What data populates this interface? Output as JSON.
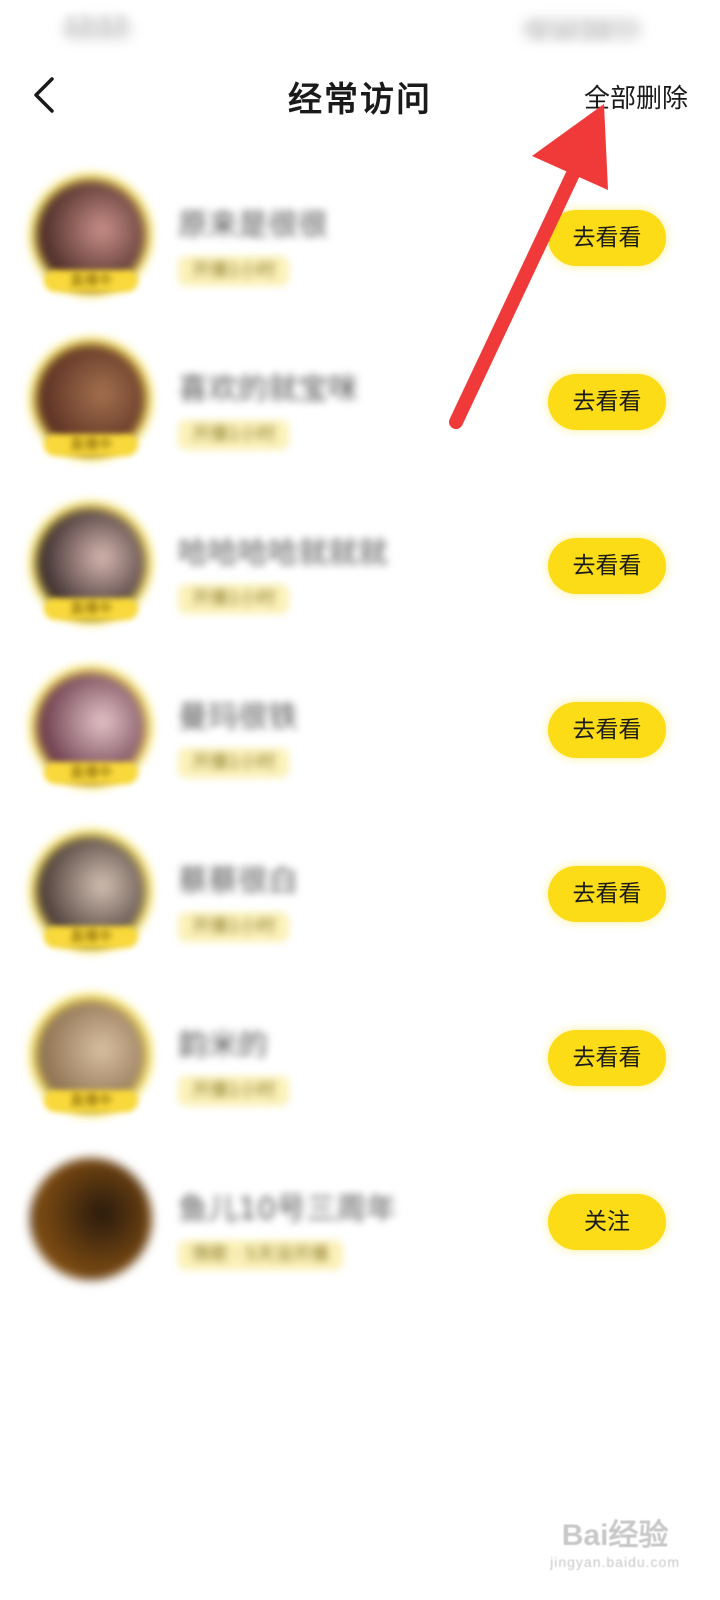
{
  "status_bar": {
    "left_text": "12:17",
    "right_text": "令 al 38"
  },
  "header": {
    "title": "经常访问",
    "delete_all_label": "全部删除"
  },
  "list": [
    {
      "name": "原来是很很",
      "tag": "开播1小时",
      "badge": "直播中",
      "action": "去看看",
      "avatar_colors": [
        "#4a2a26",
        "#c98f88"
      ]
    },
    {
      "name": "喜欢的就宝咪",
      "tag": "开播1小时",
      "badge": "直播中",
      "action": "去看看",
      "avatar_colors": [
        "#5a3022",
        "#a4704e"
      ]
    },
    {
      "name": "哈哈哈哈就就就",
      "tag": "开播1小时",
      "badge": "直播中",
      "action": "去看看",
      "avatar_colors": [
        "#3a2c2c",
        "#d7b7b0"
      ]
    },
    {
      "name": "曼玛很铁",
      "tag": "开播1小时",
      "badge": "直播中",
      "action": "去看看",
      "avatar_colors": [
        "#6a3a4a",
        "#e3c3c8"
      ]
    },
    {
      "name": "蔡蔡很白",
      "tag": "开播1小时",
      "badge": "直播中",
      "action": "去看看",
      "avatar_colors": [
        "#4a3b36",
        "#d2c0b2"
      ]
    },
    {
      "name": "韵米的",
      "tag": "开播1小时",
      "badge": "直播中",
      "action": "去看看",
      "avatar_colors": [
        "#8c7050",
        "#d8c0a0"
      ]
    },
    {
      "name": "鱼儿10号三周年",
      "tag": "情歌 · 5天没开播",
      "badge": "",
      "action": "关注",
      "avatar_colors": [
        "#7a4a12",
        "#2a1a0c"
      ]
    }
  ],
  "watermark": {
    "main": "Bai经验",
    "sub": "jingyan.baidu.com"
  },
  "colors": {
    "accent": "#fbdc16",
    "arrow": "#f03a3a"
  }
}
